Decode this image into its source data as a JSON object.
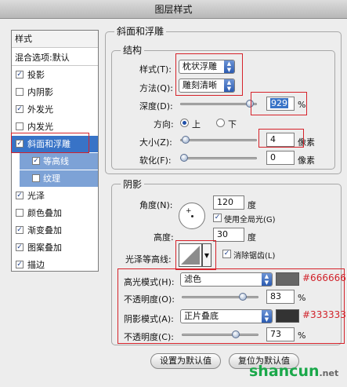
{
  "window": {
    "title": "图层样式"
  },
  "sidebar": {
    "header": "样式",
    "blend_options": "混合选项:默认",
    "items": [
      {
        "label": "投影",
        "checked": true
      },
      {
        "label": "内阴影",
        "checked": false
      },
      {
        "label": "外发光",
        "checked": true
      },
      {
        "label": "内发光",
        "checked": false
      },
      {
        "label": "斜面和浮雕",
        "checked": true,
        "selected": true
      },
      {
        "label": "等高线",
        "checked": true,
        "sub": true
      },
      {
        "label": "纹理",
        "checked": false,
        "sub": true
      },
      {
        "label": "光泽",
        "checked": true
      },
      {
        "label": "颜色叠加",
        "checked": false
      },
      {
        "label": "渐变叠加",
        "checked": true
      },
      {
        "label": "图案叠加",
        "checked": true
      },
      {
        "label": "描边",
        "checked": true
      }
    ]
  },
  "bevel": {
    "title": "斜面和浮雕",
    "structure": {
      "title": "结构",
      "style_label": "样式(T):",
      "style_value": "枕状浮雕",
      "technique_label": "方法(Q):",
      "technique_value": "雕刻清晰",
      "depth_label": "深度(D):",
      "depth_value": "929",
      "depth_unit": "%",
      "depth_level": 0.95,
      "direction_label": "方向:",
      "direction_up": "上",
      "direction_down": "下",
      "direction_selected": "up",
      "size_label": "大小(Z):",
      "size_value": "4",
      "size_unit": "像素",
      "size_level": 0.02,
      "soften_label": "软化(F):",
      "soften_value": "0",
      "soften_unit": "像素",
      "soften_level": 0.0
    },
    "shading": {
      "title": "阴影",
      "angle_label": "角度(N):",
      "angle_value": "120",
      "angle_unit": "度",
      "global_light_label": "使用全局光(G)",
      "global_light_checked": true,
      "altitude_label": "高度:",
      "altitude_value": "30",
      "altitude_unit": "度",
      "gloss_contour_label": "光泽等高线:",
      "anti_alias_label": "消除锯齿(L)",
      "anti_alias_checked": true,
      "highlight_mode_label": "高光模式(H):",
      "highlight_mode_value": "滤色",
      "highlight_color": "#666666",
      "highlight_hex": "#666666",
      "highlight_opacity_label": "不透明度(O):",
      "highlight_opacity_value": "83",
      "highlight_opacity_level": 0.83,
      "opacity_unit": "%",
      "shadow_mode_label": "阴影模式(A):",
      "shadow_mode_value": "正片叠底",
      "shadow_color": "#333333",
      "shadow_hex": "#333333",
      "shadow_opacity_label": "不透明度(C):",
      "shadow_opacity_value": "73",
      "shadow_opacity_level": 0.73
    },
    "buttons": {
      "make_default": "设置为默认值",
      "reset_default": "复位为默认值"
    }
  },
  "watermark": {
    "text": "shancun",
    "suffix": ".net",
    "brand_color": "#1aa84a"
  }
}
